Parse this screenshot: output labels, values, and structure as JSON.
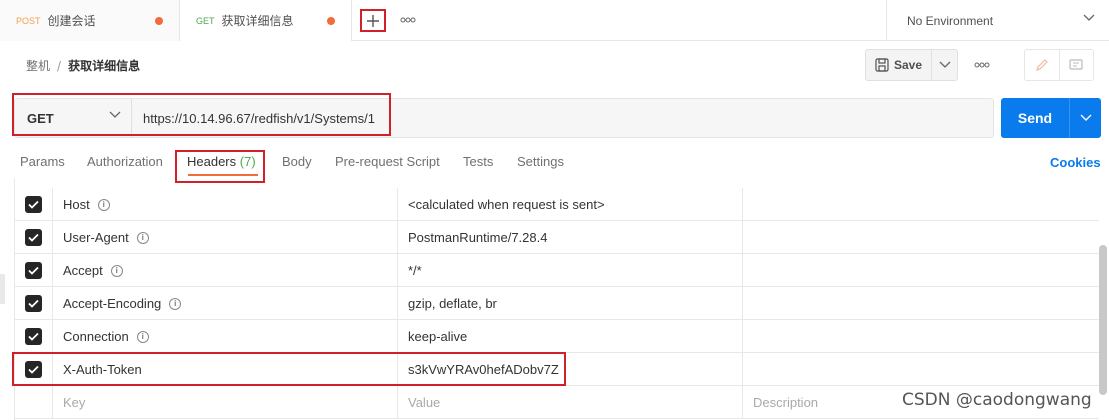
{
  "tabs": [
    {
      "method": "POST",
      "name": "创建会话",
      "unsaved": true
    },
    {
      "method": "GET",
      "name": "获取详细信息",
      "unsaved": true
    }
  ],
  "new_tab_icon": "plus-icon",
  "more_tabs_label": "ooo",
  "environment": {
    "label": "No Environment"
  },
  "breadcrumb": {
    "collection": "整机",
    "separator": "/",
    "request": "获取详细信息"
  },
  "toolbar": {
    "save_label": "Save",
    "more_label": "ooo"
  },
  "request": {
    "method": "GET",
    "url": "https://10.14.96.67/redfish/v1/Systems/1"
  },
  "send_label": "Send",
  "request_tabs": {
    "params": "Params",
    "authorization": "Authorization",
    "headers": "Headers",
    "headers_count": "(7)",
    "body": "Body",
    "prerequest": "Pre-request Script",
    "tests": "Tests",
    "settings": "Settings"
  },
  "cookies_label": "Cookies",
  "headers": [
    {
      "key": "Host",
      "value": "<calculated when request is sent>",
      "checked": true,
      "info": true
    },
    {
      "key": "User-Agent",
      "value": "PostmanRuntime/7.28.4",
      "checked": true,
      "info": true
    },
    {
      "key": "Accept",
      "value": "*/*",
      "checked": true,
      "info": true
    },
    {
      "key": "Accept-Encoding",
      "value": "gzip, deflate, br",
      "checked": true,
      "info": true
    },
    {
      "key": "Connection",
      "value": "keep-alive",
      "checked": true,
      "info": true
    },
    {
      "key": "X-Auth-Token",
      "value": "s3kVwYRAv0hefADobv7Z",
      "checked": true,
      "info": false
    }
  ],
  "placeholder_row": {
    "key": "Key",
    "value": "Value",
    "description": "Description"
  },
  "watermark": "CSDN @caodongwang",
  "colors": {
    "accent": "#097bed",
    "active_tab": "#f26b3a",
    "highlight": "#d0212a"
  }
}
